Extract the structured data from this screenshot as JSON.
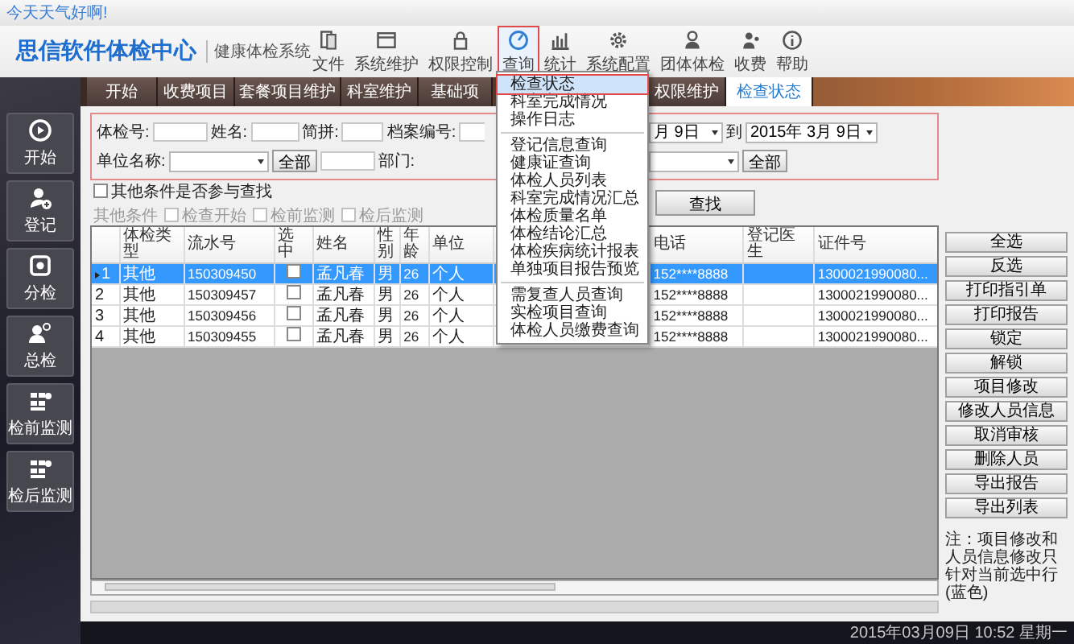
{
  "top_strip": {
    "greeting": "今天天气好啊!"
  },
  "header": {
    "logo": "思信软件体检中心",
    "subtitle": "健康体检系统"
  },
  "toolbar": [
    {
      "label": "文件",
      "selected": false
    },
    {
      "label": "系统维护",
      "selected": false
    },
    {
      "label": "权限控制",
      "selected": false
    },
    {
      "label": "查询",
      "selected": true
    },
    {
      "label": "统计",
      "selected": false
    },
    {
      "label": "系统配置",
      "selected": false
    },
    {
      "label": "团体体检",
      "selected": false
    },
    {
      "label": "收费",
      "selected": false
    },
    {
      "label": "帮助",
      "selected": false
    }
  ],
  "query_menu": {
    "groups": [
      [
        {
          "label": "检查状态",
          "selected": true
        },
        {
          "label": "科室完成情况",
          "selected": false
        },
        {
          "label": "操作日志",
          "selected": false
        }
      ],
      [
        {
          "label": "登记信息查询",
          "selected": false
        },
        {
          "label": "健康证查询",
          "selected": false
        },
        {
          "label": "体检人员列表",
          "selected": false
        },
        {
          "label": "科室完成情况汇总",
          "selected": false
        },
        {
          "label": "体检质量名单",
          "selected": false
        },
        {
          "label": "体检结论汇总",
          "selected": false
        },
        {
          "label": "体检疾病统计报表",
          "selected": false
        },
        {
          "label": "单独项目报告预览",
          "selected": false
        }
      ],
      [
        {
          "label": "需复查人员查询",
          "selected": false
        },
        {
          "label": "实检项目查询",
          "selected": false
        },
        {
          "label": "体检人员缴费查询",
          "selected": false
        }
      ]
    ]
  },
  "tabs": [
    {
      "label": "开始",
      "selected": false
    },
    {
      "label": "收费项目",
      "selected": false
    },
    {
      "label": "套餐项目维护",
      "selected": false
    },
    {
      "label": "科室维护",
      "selected": false
    },
    {
      "label": "基础项",
      "selected": false
    },
    {
      "label": "权限维护",
      "selected": false
    },
    {
      "label": "检查状态",
      "selected": true
    }
  ],
  "sidebar": [
    "开始",
    "登记",
    "分检",
    "总检",
    "检前监测",
    "检后监测"
  ],
  "search_form": {
    "exam_no_label": "体检号:",
    "name_label": "姓名:",
    "pinyin_label": "简拼:",
    "file_no_label": "档案编号:",
    "date_from": "月 9日",
    "date_to_label": "到",
    "date_to": "2015年 3月 9日",
    "unit_label": "单位名称:",
    "unit_all_button": "全部",
    "dept_label": "部门:",
    "dept_all_button": "全部"
  },
  "options": {
    "other_conditions": {
      "label": "其他条件是否参与查找",
      "checked": false
    },
    "group_label": "其他条件",
    "checkboxes": [
      {
        "label": "检查开始",
        "checked": false,
        "disabled": true
      },
      {
        "label": "检前监测",
        "checked": false,
        "disabled": true
      },
      {
        "label": "检后监测",
        "checked": false,
        "disabled": true
      }
    ],
    "search_button": "查找"
  },
  "table": {
    "columns": [
      {
        "label": "体检类型",
        "kind": "text"
      },
      {
        "label": "流水号",
        "kind": "text"
      },
      {
        "label": "选中",
        "kind": "check"
      },
      {
        "label": "姓名",
        "kind": "text"
      },
      {
        "label": "性别",
        "kind": "text"
      },
      {
        "label": "年龄",
        "kind": "text"
      },
      {
        "label": "单位",
        "kind": "text"
      },
      {
        "label": "电话",
        "kind": "text"
      },
      {
        "label": "登记医生",
        "kind": "text"
      },
      {
        "label": "证件号",
        "kind": "text"
      }
    ],
    "rows": [
      {
        "number": "1",
        "selected": true,
        "current": true,
        "checked": false,
        "cells": [
          "其他",
          "150309450",
          null,
          "孟凡春",
          "男",
          "26",
          "个人",
          "152****8888",
          null,
          "1300021990080..."
        ]
      },
      {
        "number": "2",
        "selected": false,
        "current": false,
        "checked": false,
        "cells": [
          "其他",
          "150309457",
          null,
          "孟凡春",
          "男",
          "26",
          "个人",
          "152****8888",
          null,
          "1300021990080..."
        ]
      },
      {
        "number": "3",
        "selected": false,
        "current": false,
        "checked": false,
        "cells": [
          "其他",
          "150309456",
          null,
          "孟凡春",
          "男",
          "26",
          "个人",
          "152****8888",
          null,
          "1300021990080..."
        ]
      },
      {
        "number": "4",
        "selected": false,
        "current": false,
        "checked": false,
        "cells": [
          "其他",
          "150309455",
          null,
          "孟凡春",
          "男",
          "26",
          "个人",
          "152****8888",
          null,
          "1300021990080..."
        ]
      }
    ]
  },
  "progress_bar": {
    "level": 0
  },
  "actions": [
    "全选",
    "反选",
    "打印指引单",
    "打印报告",
    "锁定",
    "解锁",
    "项目修改",
    "修改人员信息",
    "取消审核",
    "删除人员",
    "导出报告",
    "导出列表"
  ],
  "note": "注：项目修改和人员信息修改只针对当前选中行(蓝色)",
  "status_bar": {
    "datetime": "2015年03月09日 10:52 星期一"
  }
}
